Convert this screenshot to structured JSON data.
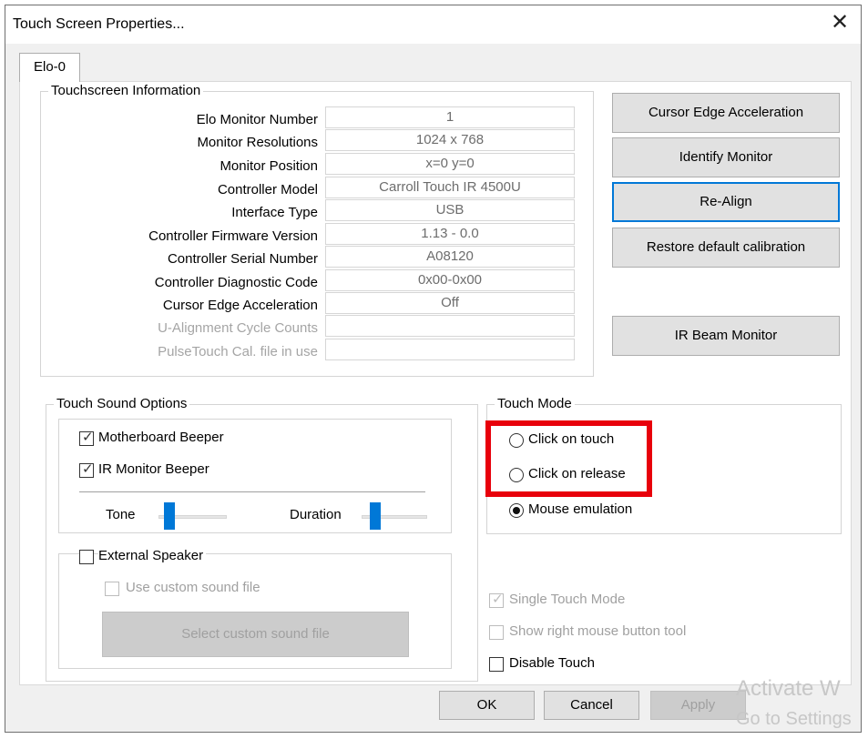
{
  "window": {
    "title": "Touch Screen Properties...",
    "close_glyph": "✕"
  },
  "tabs": [
    {
      "label": "Elo-0"
    }
  ],
  "info": {
    "title": "Touchscreen Information",
    "rows": [
      {
        "label": "Elo Monitor Number",
        "value": "1"
      },
      {
        "label": "Monitor Resolutions",
        "value": "1024 x 768"
      },
      {
        "label": "Monitor Position",
        "value": "x=0  y=0"
      },
      {
        "label": "Controller Model",
        "value": "Carroll Touch IR 4500U"
      },
      {
        "label": "Interface Type",
        "value": "USB"
      },
      {
        "label": "Controller Firmware Version",
        "value": "1.13 - 0.0"
      },
      {
        "label": "Controller Serial Number",
        "value": "A08120"
      },
      {
        "label": "Controller Diagnostic Code",
        "value": "0x00-0x00"
      },
      {
        "label": "Cursor Edge Acceleration",
        "value": "Off"
      },
      {
        "label": "U-Alignment Cycle Counts",
        "value": ""
      },
      {
        "label": "PulseTouch Cal. file in use",
        "value": ""
      }
    ]
  },
  "actions": {
    "cursor_edge": "Cursor Edge Acceleration",
    "identify": "Identify Monitor",
    "realign": "Re-Align",
    "restore": "Restore default calibration",
    "ir_beam": "IR Beam Monitor"
  },
  "sound": {
    "title": "Touch Sound Options",
    "motherboard": {
      "label": "Motherboard Beeper",
      "checked": true
    },
    "ir_monitor": {
      "label": "IR Monitor Beeper",
      "checked": true
    },
    "tone_label": "Tone",
    "duration_label": "Duration",
    "external": {
      "label": "External Speaker",
      "checked": false
    },
    "custom_file": {
      "label": "Use custom sound file",
      "checked": false
    },
    "select_button": "Select custom sound file"
  },
  "touch_mode": {
    "title": "Touch Mode",
    "options": [
      {
        "label": "Click on touch",
        "selected": false
      },
      {
        "label": "Click on release",
        "selected": false
      },
      {
        "label": "Mouse emulation",
        "selected": true
      }
    ]
  },
  "options": {
    "single_touch": {
      "label": "Single Touch Mode",
      "checked": true
    },
    "right_mouse": {
      "label": "Show right mouse button tool",
      "checked": false
    },
    "disable_touch": {
      "label": "Disable Touch",
      "checked": false
    }
  },
  "footer": {
    "ok": "OK",
    "cancel": "Cancel",
    "apply": "Apply"
  },
  "watermark": {
    "line1": "Activate W",
    "line2": "Go to Settings"
  },
  "colors": {
    "highlight": "#e8000b",
    "accent": "#0078d7"
  }
}
